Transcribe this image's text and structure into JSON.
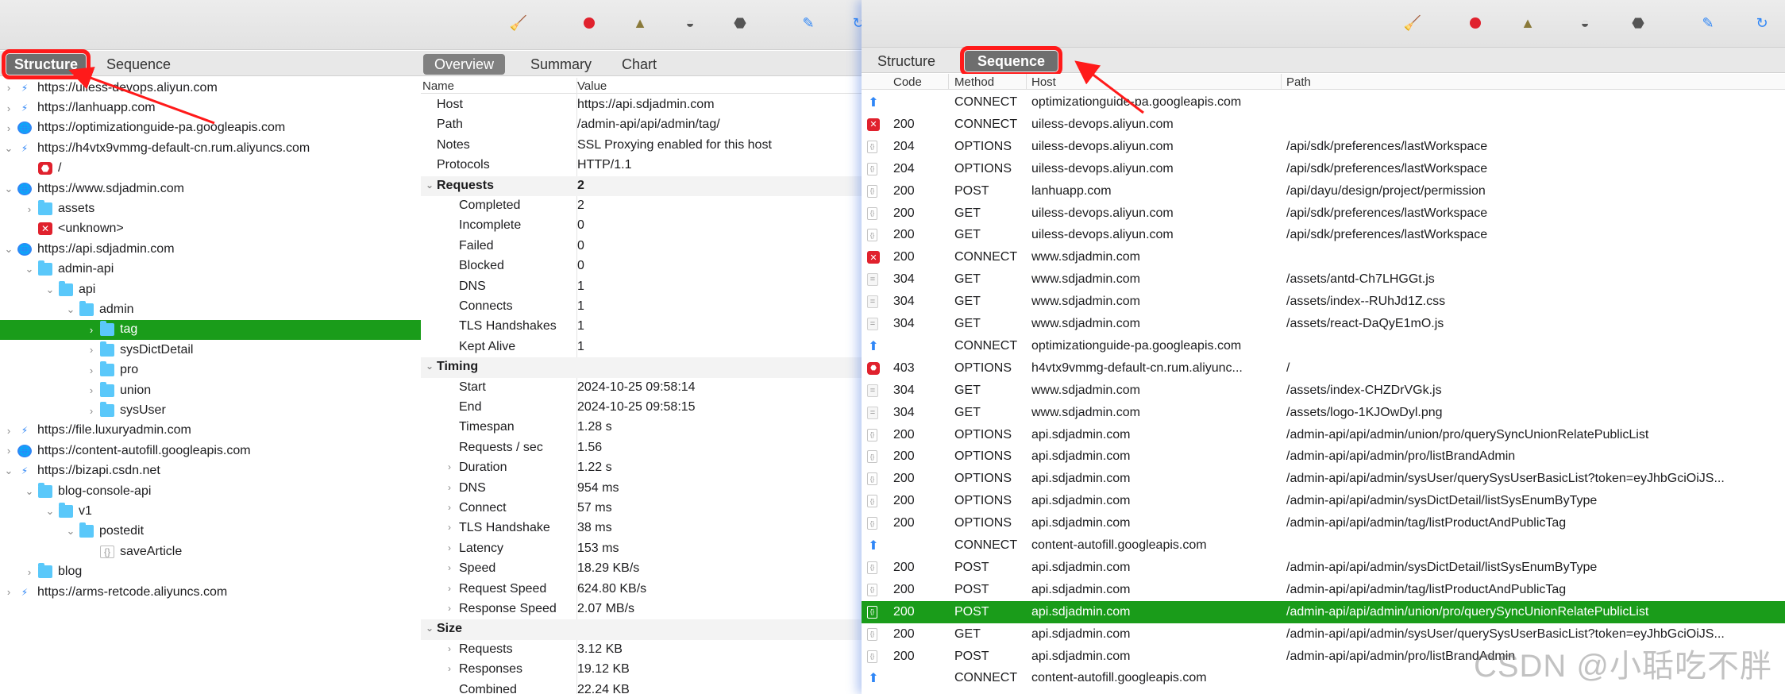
{
  "left": {
    "tabs": {
      "structure": "Structure",
      "sequence": "Sequence"
    },
    "tree": [
      {
        "label": "https://uiless-devops.aliyun.com",
        "icon": "bolt",
        "depth": 0,
        "chev": "›"
      },
      {
        "label": "https://lanhuapp.com",
        "icon": "bolt",
        "depth": 0,
        "chev": "›"
      },
      {
        "label": "https://optimizationguide-pa.googleapis.com",
        "icon": "globe",
        "depth": 0,
        "chev": "›"
      },
      {
        "label": "https://h4vtx9vmmg-default-cn.rum.aliyuncs.com",
        "icon": "bolt",
        "depth": 0,
        "chev": "⌄"
      },
      {
        "label": "/",
        "icon": "stop",
        "depth": 1,
        "chev": ""
      },
      {
        "label": "https://www.sdjadmin.com",
        "icon": "globe",
        "depth": 0,
        "chev": "⌄"
      },
      {
        "label": "assets",
        "icon": "folder",
        "depth": 1,
        "chev": "›"
      },
      {
        "label": "<unknown>",
        "icon": "x",
        "depth": 1,
        "chev": ""
      },
      {
        "label": "https://api.sdjadmin.com",
        "icon": "globe",
        "depth": 0,
        "chev": "⌄"
      },
      {
        "label": "admin-api",
        "icon": "folder",
        "depth": 1,
        "chev": "⌄"
      },
      {
        "label": "api",
        "icon": "folder",
        "depth": 2,
        "chev": "⌄"
      },
      {
        "label": "admin",
        "icon": "folder",
        "depth": 3,
        "chev": "⌄"
      },
      {
        "label": "tag",
        "icon": "folder",
        "depth": 4,
        "chev": "›",
        "selected": true
      },
      {
        "label": "sysDictDetail",
        "icon": "folder",
        "depth": 4,
        "chev": "›"
      },
      {
        "label": "pro",
        "icon": "folder",
        "depth": 4,
        "chev": "›"
      },
      {
        "label": "union",
        "icon": "folder",
        "depth": 4,
        "chev": "›"
      },
      {
        "label": "sysUser",
        "icon": "folder",
        "depth": 4,
        "chev": "›"
      },
      {
        "label": "https://file.luxuryadmin.com",
        "icon": "bolt",
        "depth": 0,
        "chev": "›"
      },
      {
        "label": "https://content-autofill.googleapis.com",
        "icon": "globe",
        "depth": 0,
        "chev": "›"
      },
      {
        "label": "https://bizapi.csdn.net",
        "icon": "bolt",
        "depth": 0,
        "chev": "⌄"
      },
      {
        "label": "blog-console-api",
        "icon": "folder",
        "depth": 1,
        "chev": "⌄"
      },
      {
        "label": "v1",
        "icon": "folder",
        "depth": 2,
        "chev": "⌄"
      },
      {
        "label": "postedit",
        "icon": "folder",
        "depth": 3,
        "chev": "⌄"
      },
      {
        "label": "saveArticle",
        "icon": "file",
        "depth": 4,
        "chev": ""
      },
      {
        "label": "blog",
        "icon": "folder",
        "depth": 1,
        "chev": "›"
      },
      {
        "label": "https://arms-retcode.aliyuncs.com",
        "icon": "bolt",
        "depth": 0,
        "chev": "›"
      }
    ],
    "detail_tabs": {
      "overview": "Overview",
      "summary": "Summary",
      "chart": "Chart"
    },
    "detail_head": {
      "name": "Name",
      "value": "Value"
    },
    "detail": [
      {
        "name": "Host",
        "value": "https://api.sdjadmin.com",
        "indent": 1
      },
      {
        "name": "Path",
        "value": "/admin-api/api/admin/tag/",
        "indent": 1
      },
      {
        "name": "Notes",
        "value": "SSL Proxying enabled for this host",
        "indent": 1
      },
      {
        "name": "Protocols",
        "value": "HTTP/1.1",
        "indent": 1
      },
      {
        "name": "Requests",
        "value": "2",
        "indent": 0,
        "group": true,
        "chev": "⌄"
      },
      {
        "name": "Completed",
        "value": "2",
        "indent": 2
      },
      {
        "name": "Incomplete",
        "value": "0",
        "indent": 2
      },
      {
        "name": "Failed",
        "value": "0",
        "indent": 2
      },
      {
        "name": "Blocked",
        "value": "0",
        "indent": 2
      },
      {
        "name": "DNS",
        "value": "1",
        "indent": 2
      },
      {
        "name": "Connects",
        "value": "1",
        "indent": 2
      },
      {
        "name": "TLS Handshakes",
        "value": "1",
        "indent": 2
      },
      {
        "name": "Kept Alive",
        "value": "1",
        "indent": 2
      },
      {
        "name": "Timing",
        "value": "",
        "indent": 0,
        "group": true,
        "chev": "⌄"
      },
      {
        "name": "Start",
        "value": "2024-10-25 09:58:14",
        "indent": 2
      },
      {
        "name": "End",
        "value": "2024-10-25 09:58:15",
        "indent": 2
      },
      {
        "name": "Timespan",
        "value": "1.28 s",
        "indent": 2
      },
      {
        "name": "Requests / sec",
        "value": "1.56",
        "indent": 2
      },
      {
        "name": "Duration",
        "value": "1.22 s",
        "indent": 2,
        "chev": "›"
      },
      {
        "name": "DNS",
        "value": "954 ms",
        "indent": 2,
        "chev": "›"
      },
      {
        "name": "Connect",
        "value": "57 ms",
        "indent": 2,
        "chev": "›"
      },
      {
        "name": "TLS Handshake",
        "value": "38 ms",
        "indent": 2,
        "chev": "›"
      },
      {
        "name": "Latency",
        "value": "153 ms",
        "indent": 2,
        "chev": "›"
      },
      {
        "name": "Speed",
        "value": "18.29 KB/s",
        "indent": 2,
        "chev": "›"
      },
      {
        "name": "Request Speed",
        "value": "624.80 KB/s",
        "indent": 2,
        "chev": "›"
      },
      {
        "name": "Response Speed",
        "value": "2.07 MB/s",
        "indent": 2,
        "chev": "›"
      },
      {
        "name": "Size",
        "value": "",
        "indent": 0,
        "group": true,
        "chev": "⌄"
      },
      {
        "name": "Requests",
        "value": "3.12 KB",
        "indent": 2,
        "chev": "›"
      },
      {
        "name": "Responses",
        "value": "19.12 KB",
        "indent": 2,
        "chev": "›"
      },
      {
        "name": "Combined",
        "value": "22.24 KB",
        "indent": 2,
        "chev": ""
      }
    ]
  },
  "right": {
    "tabs": {
      "structure": "Structure",
      "sequence": "Sequence"
    },
    "columns": {
      "code": "Code",
      "method": "Method",
      "host": "Host",
      "path": "Path"
    },
    "rows": [
      {
        "icon": "up",
        "code": "",
        "method": "CONNECT",
        "host": "optimizationguide-pa.googleapis.com",
        "path": ""
      },
      {
        "icon": "x",
        "code": "200",
        "method": "CONNECT",
        "host": "uiless-devops.aliyun.com",
        "path": ""
      },
      {
        "icon": "file",
        "code": "204",
        "method": "OPTIONS",
        "host": "uiless-devops.aliyun.com",
        "path": "/api/sdk/preferences/lastWorkspace"
      },
      {
        "icon": "file",
        "code": "204",
        "method": "OPTIONS",
        "host": "uiless-devops.aliyun.com",
        "path": "/api/sdk/preferences/lastWorkspace"
      },
      {
        "icon": "file",
        "code": "200",
        "method": "POST",
        "host": "lanhuapp.com",
        "path": "/api/dayu/design/project/permission"
      },
      {
        "icon": "file",
        "code": "200",
        "method": "GET",
        "host": "uiless-devops.aliyun.com",
        "path": "/api/sdk/preferences/lastWorkspace"
      },
      {
        "icon": "file",
        "code": "200",
        "method": "GET",
        "host": "uiless-devops.aliyun.com",
        "path": "/api/sdk/preferences/lastWorkspace"
      },
      {
        "icon": "x",
        "code": "200",
        "method": "CONNECT",
        "host": "www.sdjadmin.com",
        "path": ""
      },
      {
        "icon": "eq",
        "code": "304",
        "method": "GET",
        "host": "www.sdjadmin.com",
        "path": "/assets/antd-Ch7LHGGt.js"
      },
      {
        "icon": "eq",
        "code": "304",
        "method": "GET",
        "host": "www.sdjadmin.com",
        "path": "/assets/index--RUhJd1Z.css"
      },
      {
        "icon": "eq",
        "code": "304",
        "method": "GET",
        "host": "www.sdjadmin.com",
        "path": "/assets/react-DaQyE1mO.js"
      },
      {
        "icon": "up",
        "code": "",
        "method": "CONNECT",
        "host": "optimizationguide-pa.googleapis.com",
        "path": ""
      },
      {
        "icon": "stop",
        "code": "403",
        "method": "OPTIONS",
        "host": "h4vtx9vmmg-default-cn.rum.aliyunc...",
        "path": "/"
      },
      {
        "icon": "eq",
        "code": "304",
        "method": "GET",
        "host": "www.sdjadmin.com",
        "path": "/assets/index-CHZDrVGk.js"
      },
      {
        "icon": "eq",
        "code": "304",
        "method": "GET",
        "host": "www.sdjadmin.com",
        "path": "/assets/logo-1KJOwDyl.png"
      },
      {
        "icon": "file",
        "code": "200",
        "method": "OPTIONS",
        "host": "api.sdjadmin.com",
        "path": "/admin-api/api/admin/union/pro/querySyncUnionRelatePublicList"
      },
      {
        "icon": "file",
        "code": "200",
        "method": "OPTIONS",
        "host": "api.sdjadmin.com",
        "path": "/admin-api/api/admin/pro/listBrandAdmin"
      },
      {
        "icon": "file",
        "code": "200",
        "method": "OPTIONS",
        "host": "api.sdjadmin.com",
        "path": "/admin-api/api/admin/sysUser/querySysUserBasicList?token=eyJhbGciOiJS..."
      },
      {
        "icon": "file",
        "code": "200",
        "method": "OPTIONS",
        "host": "api.sdjadmin.com",
        "path": "/admin-api/api/admin/sysDictDetail/listSysEnumByType"
      },
      {
        "icon": "file",
        "code": "200",
        "method": "OPTIONS",
        "host": "api.sdjadmin.com",
        "path": "/admin-api/api/admin/tag/listProductAndPublicTag"
      },
      {
        "icon": "up",
        "code": "",
        "method": "CONNECT",
        "host": "content-autofill.googleapis.com",
        "path": ""
      },
      {
        "icon": "file",
        "code": "200",
        "method": "POST",
        "host": "api.sdjadmin.com",
        "path": "/admin-api/api/admin/sysDictDetail/listSysEnumByType"
      },
      {
        "icon": "file",
        "code": "200",
        "method": "POST",
        "host": "api.sdjadmin.com",
        "path": "/admin-api/api/admin/tag/listProductAndPublicTag"
      },
      {
        "icon": "file",
        "code": "200",
        "method": "POST",
        "host": "api.sdjadmin.com",
        "path": "/admin-api/api/admin/union/pro/querySyncUnionRelatePublicList",
        "selected": true
      },
      {
        "icon": "file",
        "code": "200",
        "method": "GET",
        "host": "api.sdjadmin.com",
        "path": "/admin-api/api/admin/sysUser/querySysUserBasicList?token=eyJhbGciOiJS..."
      },
      {
        "icon": "file",
        "code": "200",
        "method": "POST",
        "host": "api.sdjadmin.com",
        "path": "/admin-api/api/admin/pro/listBrandAdmin"
      },
      {
        "icon": "up",
        "code": "",
        "method": "CONNECT",
        "host": "content-autofill.googleapis.com",
        "path": ""
      }
    ]
  },
  "watermark": "CSDN @小聒吃不胖",
  "colors": {
    "selected": "#1a9c1a",
    "highlight": "#ff1a1a",
    "accent": "#2f86f6"
  }
}
